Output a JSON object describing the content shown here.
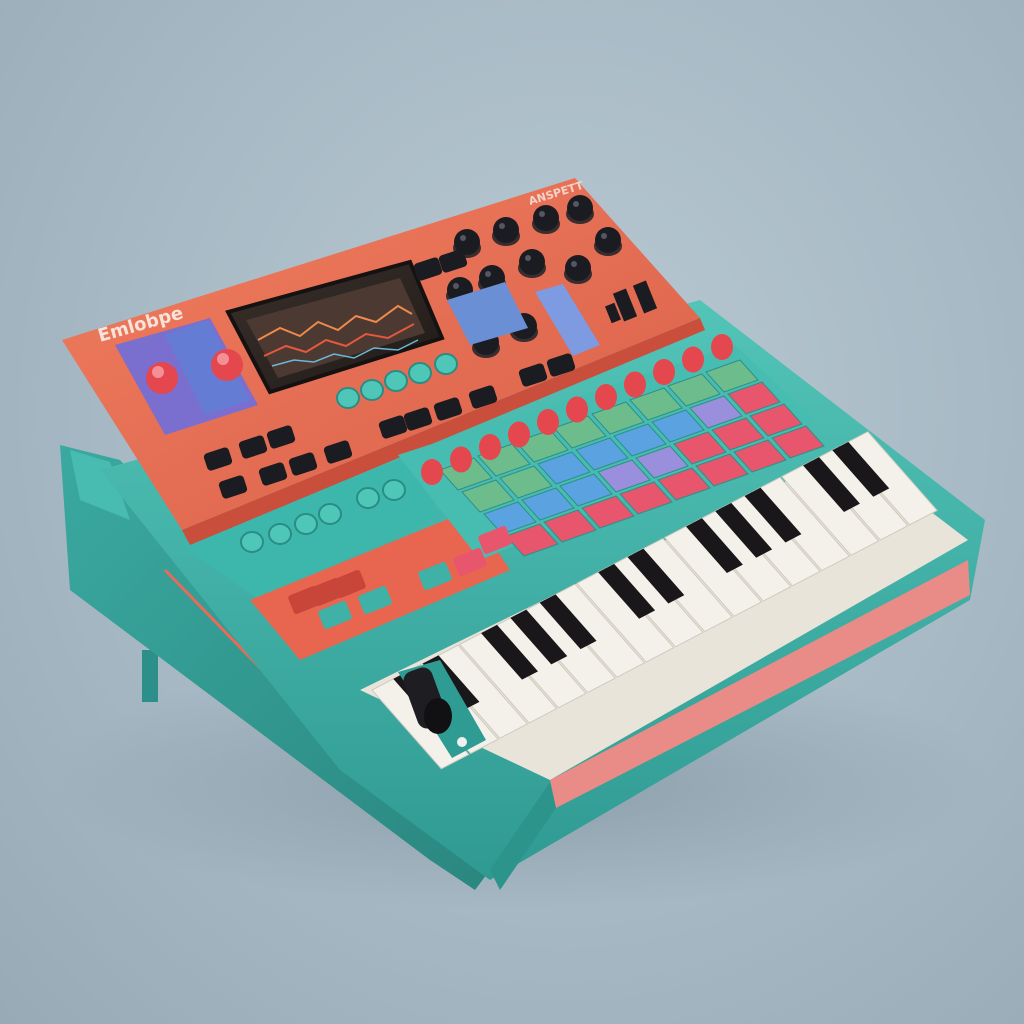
{
  "product": {
    "brand_text": "Emlobpe",
    "model_text": "ANSPETT"
  },
  "colors": {
    "background": "#a9bbc6",
    "coral_panel": "#e56f52",
    "teal_body": "#3fb1a6",
    "knob_black": "#1b1c22",
    "knob_red": "#e5474f",
    "pad_pink": "#e8566e",
    "pad_blue": "#5aa3e0",
    "pad_green": "#6dbd8c",
    "screen_bg": "#2b2420",
    "white_key": "#f4f1ea",
    "black_key": "#19171a"
  },
  "screen": {
    "content": "waveform-display"
  },
  "icons": [
    "knob-icon",
    "button-icon",
    "pad-icon",
    "piano-key-icon",
    "screen-icon",
    "pitch-joystick-icon"
  ]
}
